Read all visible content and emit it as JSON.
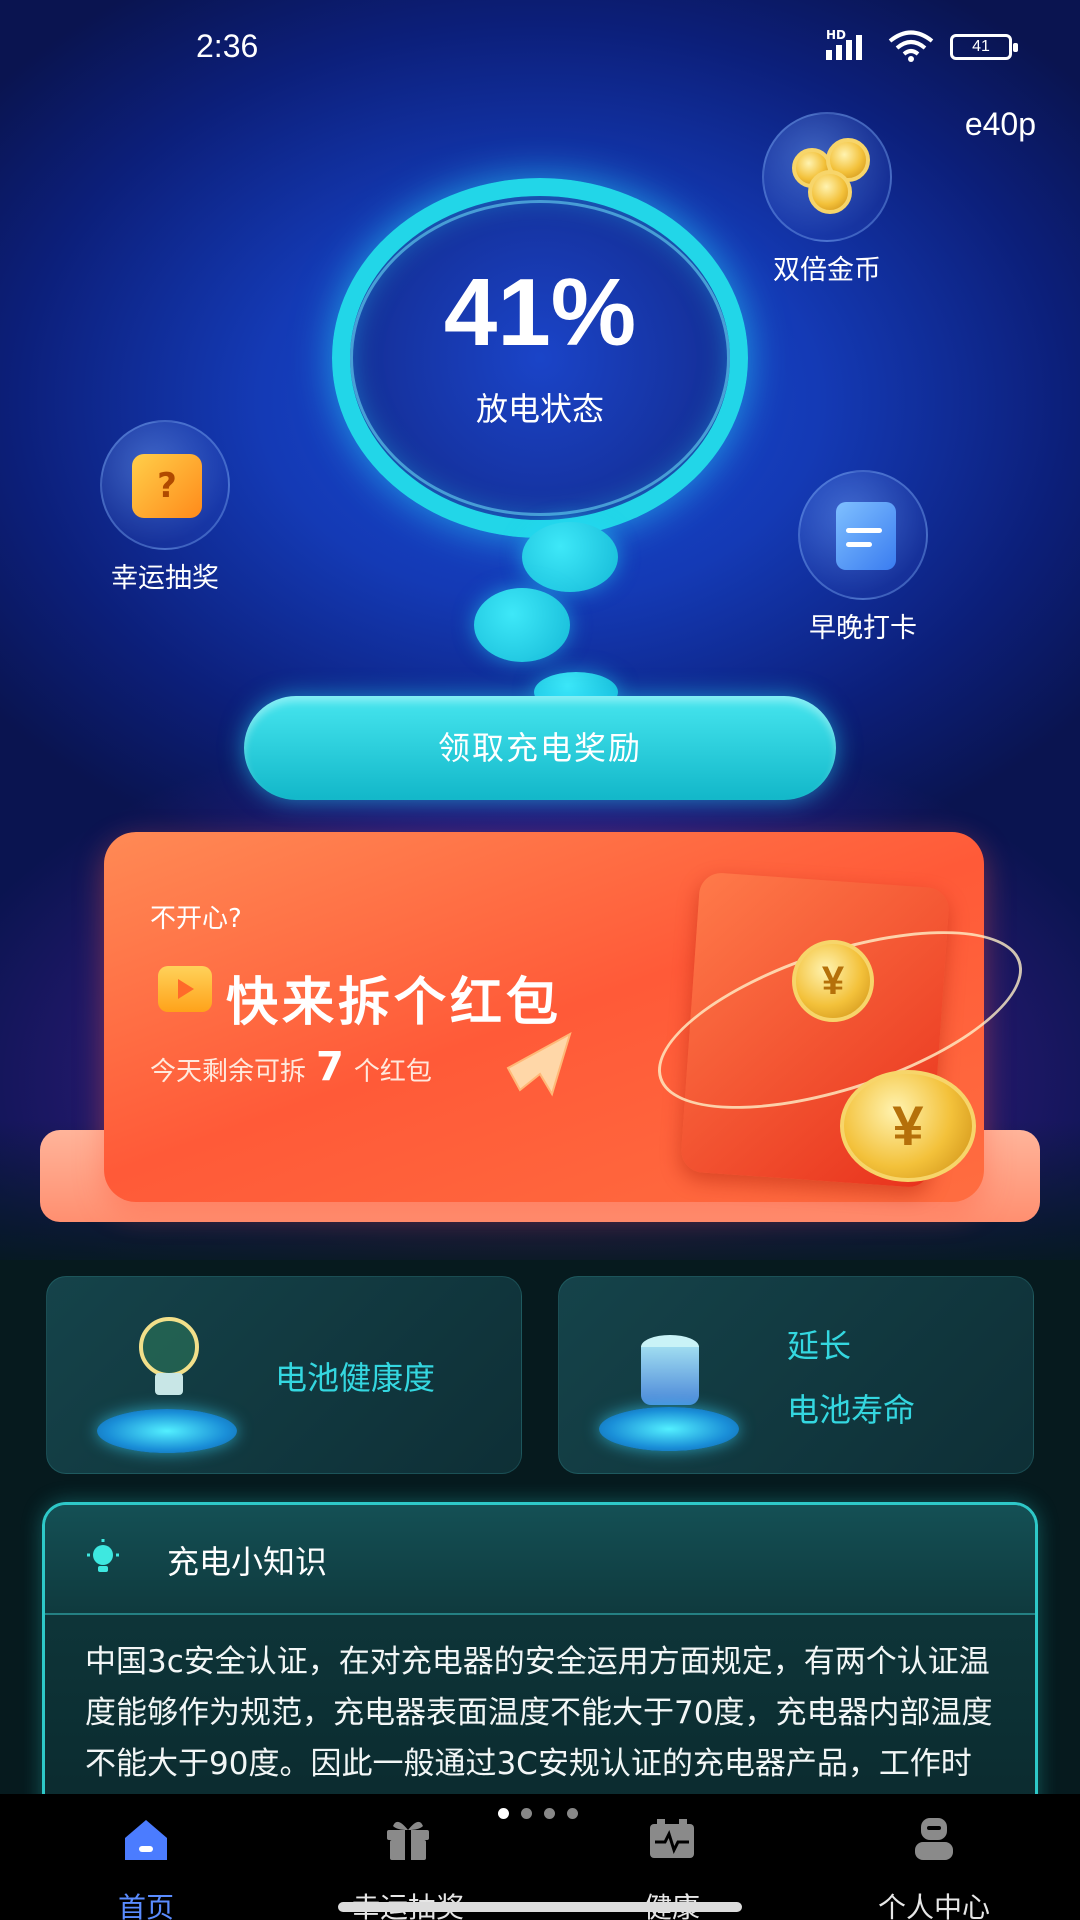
{
  "status_bar": {
    "time": "2:36",
    "battery": "41",
    "network": "HD"
  },
  "corner_code": "e40p",
  "charge": {
    "percent": "41%",
    "state": "放电状态"
  },
  "features": {
    "double_coins": "双倍金币",
    "lucky_draw": "幸运抽奖",
    "checkin": "早晚打卡"
  },
  "claim_button": "领取充电奖励",
  "red_packet": {
    "question": "不开心?",
    "title": "快来拆个红包",
    "remaining_prefix": "今天剩余可拆",
    "remaining_count": "7",
    "remaining_suffix": "个红包"
  },
  "cards": {
    "battery_health": "电池健康度",
    "extend_line1": "延长",
    "extend_line2": "电池寿命"
  },
  "knowledge": {
    "title": "充电小知识",
    "body": "中国3c安全认证，在对充电器的安全运用方面规定，有两个认证温度能够作为规范，充电器表面温度不能大于70度，充电器内部温度不能大于90度。因此一般通过3C安规认证的充电器产品，工作时一般都会在安"
  },
  "nav": {
    "items": [
      {
        "label": "首页",
        "icon": "home-icon"
      },
      {
        "label": "幸运抽奖",
        "icon": "gift-icon"
      },
      {
        "label": "健康",
        "icon": "battery-pulse-icon"
      },
      {
        "label": "个人中心",
        "icon": "user-icon"
      }
    ],
    "active_index": 0,
    "active_color": "#5a8cff"
  },
  "colors": {
    "accent": "#22d6e8",
    "banner": "#ff5a38",
    "card_text": "#34d7e0"
  }
}
